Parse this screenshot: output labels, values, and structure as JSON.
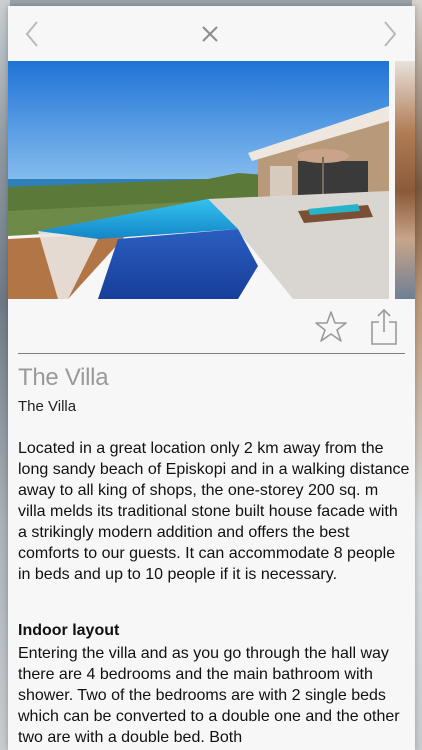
{
  "nav": {
    "prev_icon": "chevron-left-icon",
    "close_icon": "close-icon",
    "next_icon": "chevron-right-icon"
  },
  "photo": {
    "subject": "villa-pool-photo"
  },
  "actions": {
    "favorite_icon": "star-icon",
    "share_icon": "share-icon"
  },
  "content": {
    "title": "The Villa",
    "subtitle": "The Villa",
    "description": "Located in a great location only 2 km away from the long sandy beach of Episkopi and in a walking distance away to all king of shops, the one-storey 200 sq. m villa melds its traditional stone built house facade with a strikingly modern addition and offers the best comforts to our guests. It can accommodate 8 people in beds and up to 10 people if it is necessary.",
    "section_heading": "Indoor layout",
    "section_text": "Entering the villa and as you go through the hall way there are 4 bedrooms and the main bathroom with shower. Two of the bedrooms are with 2 single beds which can be converted to a double one and the other two are with a double bed. Both"
  },
  "colors": {
    "accent": "#9a9a9a",
    "divider": "#7f7f7f",
    "background": "#f7f7f7"
  }
}
